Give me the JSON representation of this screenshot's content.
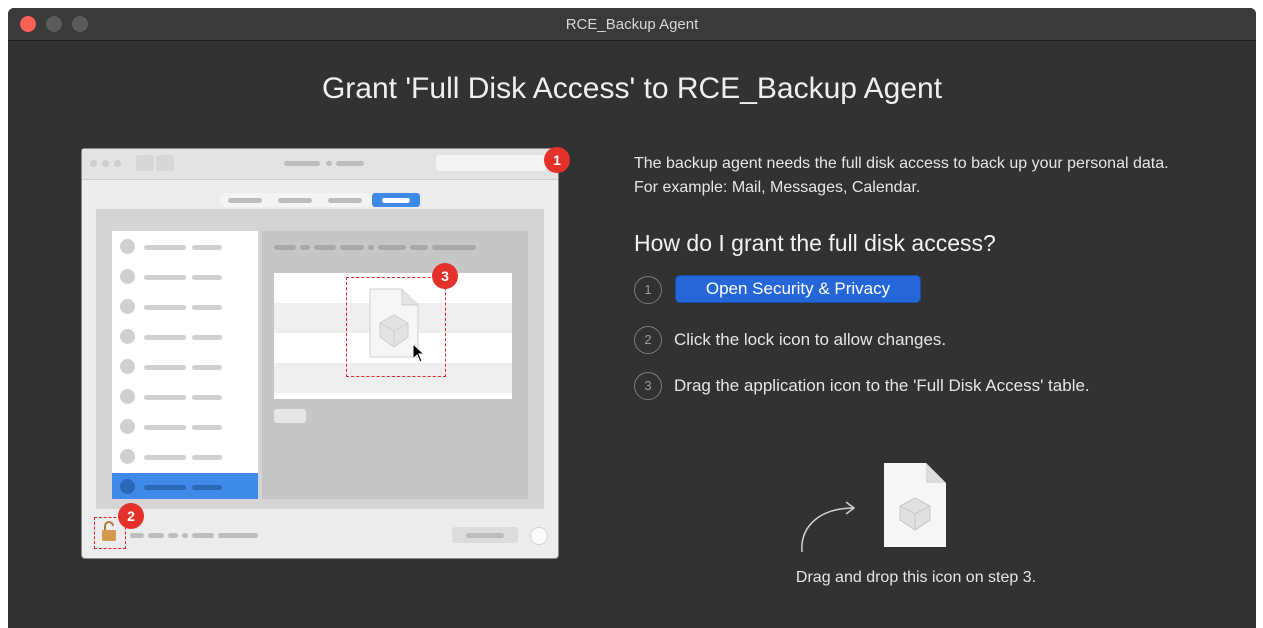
{
  "window": {
    "title": "RCE_Backup Agent",
    "traffic_lights": [
      "close",
      "minimize",
      "zoom"
    ]
  },
  "main_title": "Grant 'Full Disk Access' to RCE_Backup Agent",
  "illustration": {
    "badges": [
      "1",
      "2",
      "3"
    ]
  },
  "description": "The backup agent needs the full disk access to back up your personal data. For example: Mail, Messages, Calendar.",
  "howto_title": "How do I grant the full disk access?",
  "steps": [
    {
      "number": "1",
      "button_label": "Open Security & Privacy"
    },
    {
      "number": "2",
      "text": "Click the lock icon to allow changes."
    },
    {
      "number": "3",
      "text": "Drag the application icon to the 'Full Disk Access' table."
    }
  ],
  "drag_caption": "Drag and drop this icon on step 3.",
  "colors": {
    "background": "#323232",
    "accent_button": "#2566d8",
    "badge": "#e5312b",
    "close_light": "#fe5f57"
  }
}
